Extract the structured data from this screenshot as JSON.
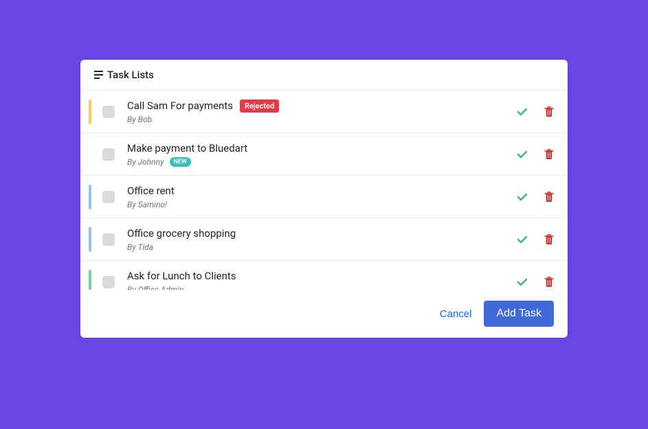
{
  "header": {
    "title": "Task Lists"
  },
  "tasks": [
    {
      "title": "Call Sam For payments",
      "by": "By Bob",
      "stripe": "warning",
      "titleBadge": "Rejected",
      "metaBadge": null
    },
    {
      "title": "Make payment to Bluedart",
      "by": "By Johnny",
      "stripe": "none",
      "titleBadge": null,
      "metaBadge": "NEW"
    },
    {
      "title": "Office rent",
      "by": "By Samino!",
      "stripe": "info",
      "titleBadge": null,
      "metaBadge": null
    },
    {
      "title": "Office grocery shopping",
      "by": "By Tida",
      "stripe": "info",
      "titleBadge": null,
      "metaBadge": null
    },
    {
      "title": "Ask for Lunch to Clients",
      "by": "By Office Admin",
      "stripe": "success",
      "titleBadge": null,
      "metaBadge": null
    }
  ],
  "footer": {
    "cancel": "Cancel",
    "addTask": "Add Task"
  },
  "colors": {
    "primary": "#3f6ad8",
    "link": "#0d6efd",
    "danger": "#e63946",
    "teal": "#3abec2",
    "success": "#3cb878",
    "deleteIcon": "#d0332f"
  }
}
